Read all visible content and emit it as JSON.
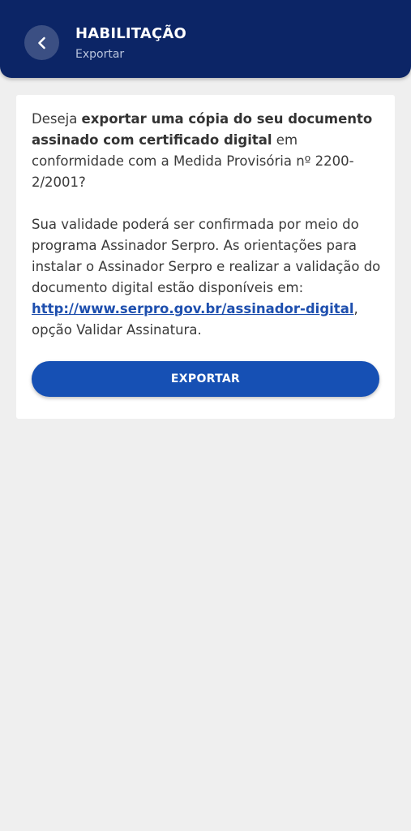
{
  "header": {
    "title": "HABILITAÇÃO",
    "subtitle": "Exportar",
    "back_icon": "chevron-left-icon"
  },
  "card": {
    "p1": {
      "pre": "Deseja ",
      "bold": "exportar uma cópia do seu documento assinado com certificado digital",
      "post": " em conformidade com a Medida Provisória nº 2200-2/2001?"
    },
    "p2": {
      "pre": "Sua validade poderá ser confirmada por meio do programa Assinador Serpro. As orientações para instalar o Assinador Serpro e realizar a validação do documento digital estão disponíveis em: ",
      "link": "http://www.serpro.gov.br/assinador-digital",
      "post": ", opção Validar Assinatura."
    },
    "export_label": "EXPORTAR"
  },
  "colors": {
    "header_bg": "#0c2566",
    "accent": "#1650b4",
    "link": "#1e4fae",
    "background": "#efefef"
  }
}
